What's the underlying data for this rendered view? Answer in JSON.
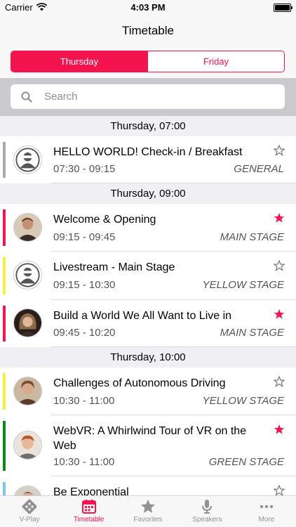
{
  "status_bar": {
    "carrier": "Carrier",
    "time": "4:03 PM"
  },
  "nav": {
    "title": "Timetable"
  },
  "segments": {
    "thursday": "Thursday",
    "friday": "Friday",
    "selected": "Thursday"
  },
  "search": {
    "placeholder": "Search"
  },
  "sections": [
    {
      "header": "Thursday, 07:00",
      "items": [
        {
          "title": "HELLO WORLD! Check-in / Breakfast",
          "time": "07:30 - 09:15",
          "track": "GENERAL",
          "bar_color": "#aaaaaa",
          "favorite": false,
          "avatar": "placeholder-avatar-icon"
        }
      ]
    },
    {
      "header": "Thursday, 09:00",
      "items": [
        {
          "title": "Welcome & Opening",
          "time": "09:15 - 09:45",
          "track": "MAIN STAGE",
          "bar_color": "#f2134f",
          "favorite": true,
          "avatar": "speaker-photo"
        },
        {
          "title": "Livestream - Main Stage",
          "time": "09:15 - 10:30",
          "track": "YELLOW STAGE",
          "bar_color": "#f5f03c",
          "favorite": false,
          "avatar": "placeholder-avatar-icon"
        },
        {
          "title": "Build a World We All Want to Live in",
          "time": "09:45 - 10:20",
          "track": "MAIN STAGE",
          "bar_color": "#f2134f",
          "favorite": true,
          "avatar": "speaker-photo"
        }
      ]
    },
    {
      "header": "Thursday, 10:00",
      "items": [
        {
          "title": "Challenges of Autonomous Driving",
          "time": "10:30 - 11:00",
          "track": "YELLOW STAGE",
          "bar_color": "#f5f03c",
          "favorite": false,
          "avatar": "speaker-photo"
        },
        {
          "title": "WebVR: A Whirlwind Tour of VR on the Web",
          "time": "10:30 - 11:00",
          "track": "GREEN STAGE",
          "bar_color": "#0a8a1a",
          "favorite": true,
          "avatar": "speaker-photo"
        },
        {
          "title": "Be Exponential",
          "time": "",
          "track": "",
          "bar_color": "#7ec8e3",
          "favorite": false,
          "avatar": "speaker-photo"
        }
      ]
    }
  ],
  "tabs": [
    {
      "label": "V-Play",
      "icon": "v-play-icon"
    },
    {
      "label": "Timetable",
      "icon": "calendar-icon"
    },
    {
      "label": "Favorites",
      "icon": "star-icon"
    },
    {
      "label": "Speakers",
      "icon": "microphone-icon"
    },
    {
      "label": "More",
      "icon": "more-icon"
    }
  ],
  "active_tab": "Timetable",
  "colors": {
    "accent": "#f2134f",
    "section_bg": "#efeff4",
    "search_bg": "#c9c9ce",
    "secondary_text": "#555555"
  }
}
